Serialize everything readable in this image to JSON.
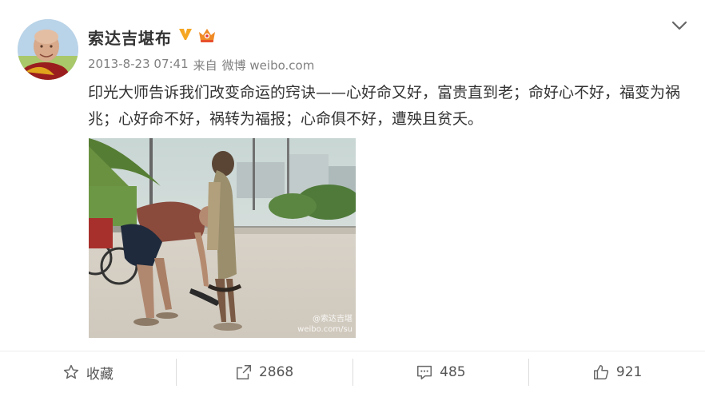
{
  "post": {
    "author": "索达吉堪布",
    "timestamp": "2013-8-23 07:41",
    "source_prefix": "来自",
    "source": "微博 weibo.com",
    "text": "印光大师告诉我们改变命运的窍诀——心好命又好，富贵直到老；命好心不好，福变为祸兆；心好命不好，祸转为福报；心命俱不好，遭殃且贫夭。",
    "verified_badge_color": "#f5a623",
    "image_watermark_line1": "@索达吉堪",
    "image_watermark_line2": "weibo.com/su"
  },
  "actions": {
    "favorite_label": "收藏",
    "repost_count": "2868",
    "comment_count": "485",
    "like_count": "921"
  },
  "icons": {
    "menu": "chevron-down-icon",
    "verified": "verified-v-icon",
    "member": "crown-member-icon",
    "favorite": "star-icon",
    "repost": "repost-icon",
    "comment": "comment-icon",
    "like": "thumbs-up-icon"
  }
}
